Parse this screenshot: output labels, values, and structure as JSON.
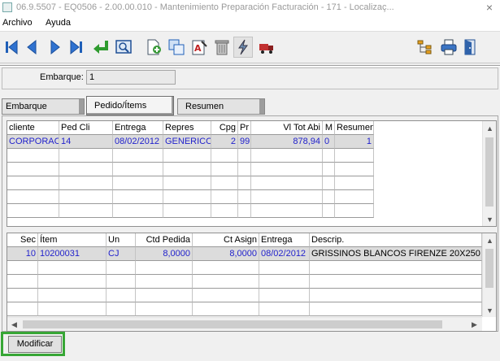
{
  "window": {
    "title": "06.9.5507 - EQ0506 - 2.00.00.010 - Mantenimiento Preparación Facturación - 171 - Localizaç...",
    "close_glyph": "×"
  },
  "menu": [
    "Archivo",
    "Ayuda"
  ],
  "toolbar": {
    "left_icons": [
      "first-record-icon",
      "previous-record-icon",
      "next-record-icon",
      "last-record-icon",
      "return-icon",
      "preview-icon",
      "new-icon",
      "copy-icon",
      "edit-text-icon",
      "delete-icon",
      "lightning-icon",
      "truck-icon"
    ],
    "right_icons": [
      "tree-icon",
      "print-icon",
      "exit-icon"
    ]
  },
  "embarque": {
    "label": "Embarque:",
    "value": "1"
  },
  "tabs": [
    {
      "label": "Embarque",
      "active": false
    },
    {
      "label": "Pedido/Ítems",
      "active": true
    },
    {
      "label": "Resumen",
      "active": false
    }
  ],
  "orders_grid": {
    "columns": [
      "cliente",
      "Ped Cli",
      "Entrega",
      "Repres",
      "Cpg",
      "Pr",
      "Vl Tot Abi",
      "M",
      "Resumen"
    ],
    "rows": [
      [
        "CORPORAC",
        "14",
        "08/02/2012",
        "GENERICO",
        "2",
        "99",
        "878,94",
        "0",
        "1"
      ]
    ]
  },
  "items_grid": {
    "columns": [
      "Sec",
      "Ítem",
      "Un",
      "Ctd Pedida",
      "Ct Asign",
      "Entrega",
      "Descrip."
    ],
    "rows": [
      [
        "10",
        "10200031",
        "CJ",
        "8,0000",
        "8,0000",
        "08/02/2012",
        "GRISSINOS BLANCOS FIRENZE 20X250"
      ]
    ]
  },
  "buttons": {
    "modificar": "Modificar"
  },
  "colors": {
    "highlight": "#37a635",
    "row_text": "#2222cc",
    "selected_row": "#dcdcdc"
  }
}
